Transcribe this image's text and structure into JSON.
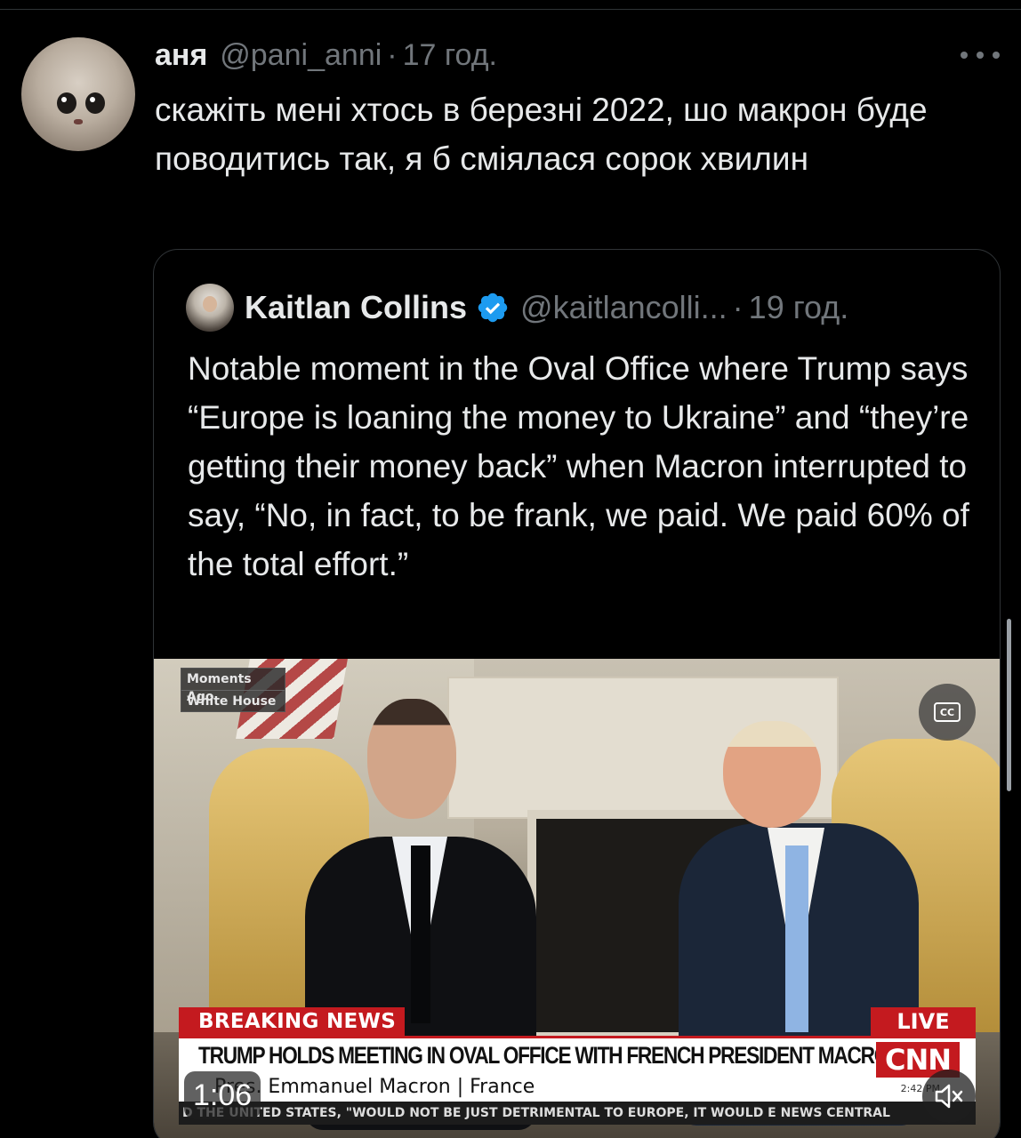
{
  "tweet": {
    "author_name": "аня",
    "author_handle": "@pani_anni",
    "time": "17 год.",
    "separator": "·",
    "text": "скажіть мені хтось в березні 2022, шо макрон буде поводитись так, я б сміялася сорок хвилин",
    "avatar_icon": "cat-avatar"
  },
  "quoted_tweet": {
    "author_name": "Kaitlan Collins",
    "verified_icon": "verified-badge-icon",
    "verified_color": "#1d9bf0",
    "author_handle": "@kaitlancolli...",
    "time": "19 год.",
    "separator": "·",
    "text": "Notable moment in the Oval Office where Trump says “Europe is loaning the money to Ukraine” and “they’re getting their money back” when Macron interrupted to say, “No, in fact, to be frank, we paid. We paid 60% of the total effort.”"
  },
  "video": {
    "tag_line1": "Moments Ago",
    "tag_line2": "White House",
    "breaking_label": "BREAKING NEWS",
    "live_label": "LIVE",
    "headline": "TRUMP HOLDS MEETING IN OVAL OFFICE WITH FRENCH PRESIDENT MACRON",
    "subline": "Pres. Emmanuel Macron  |  France",
    "network": "CNN",
    "clock": "2:42 PM",
    "ticker": "D THE UNITED STATES, \"WOULD NOT BE JUST DETRIMENTAL TO EUROPE, IT WOULD E NEWS CENTRAL",
    "timer": "1:06",
    "cc_label": "CC",
    "accent_color": "#c41a1f"
  }
}
